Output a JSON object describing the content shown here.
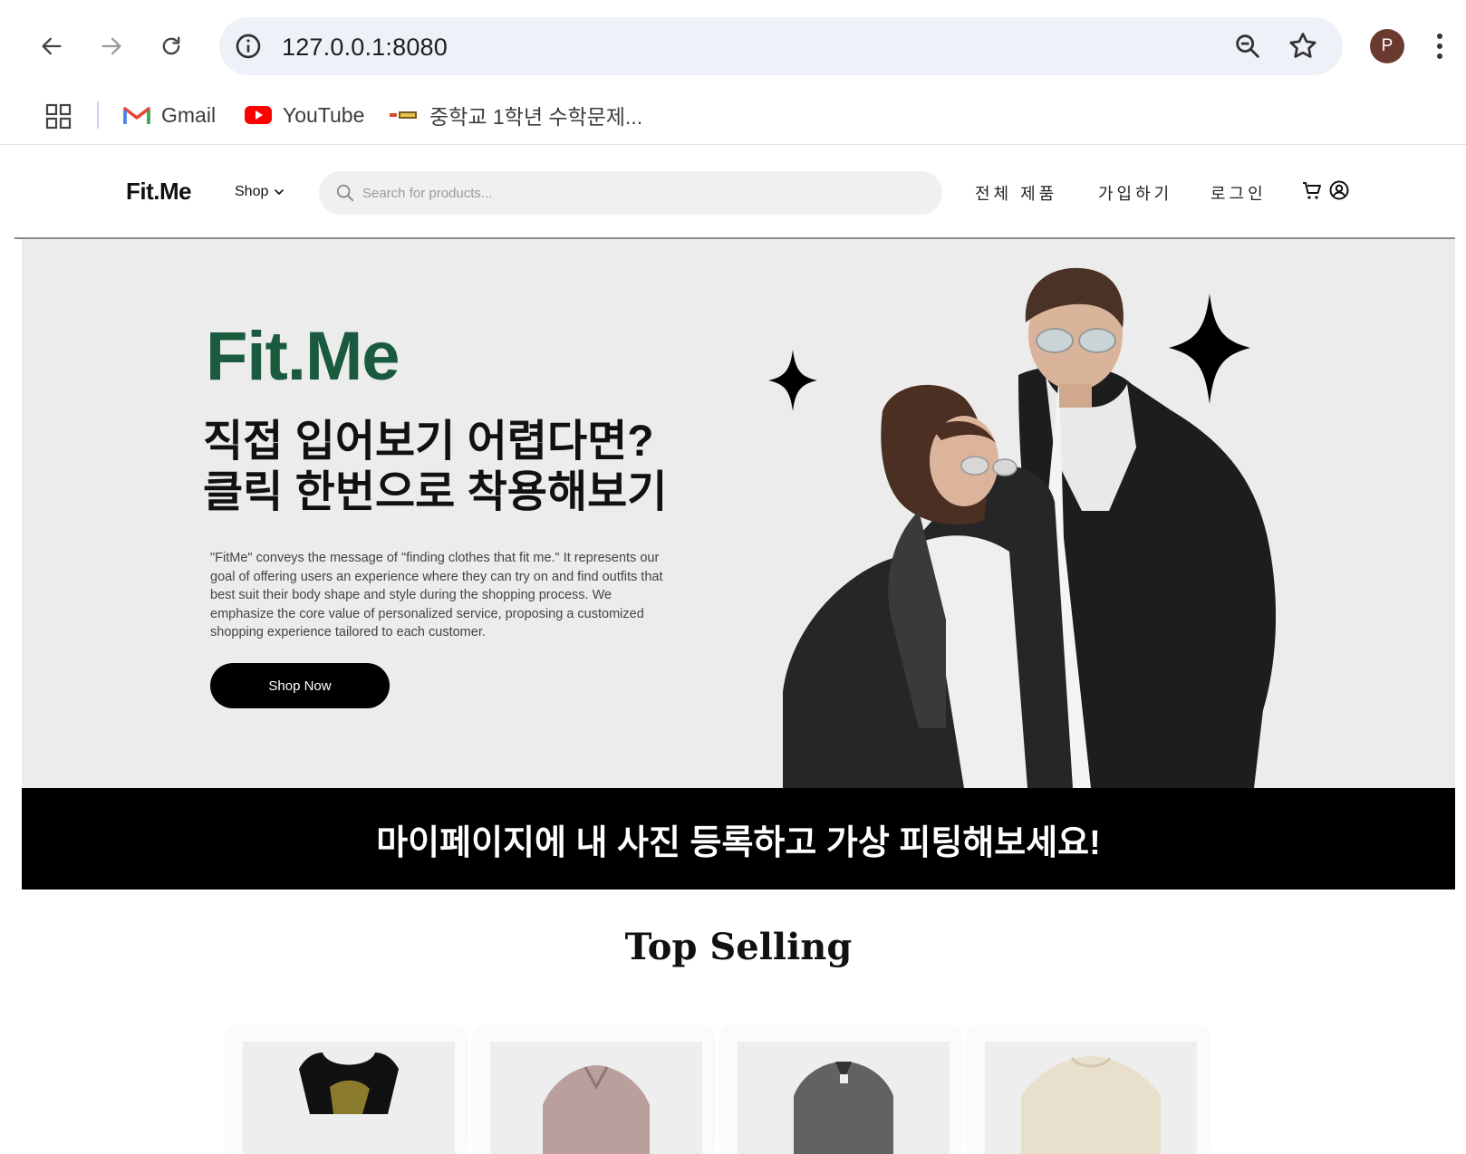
{
  "browser": {
    "url": "127.0.0.1:8080",
    "profile_initial": "P",
    "bookmarks": [
      {
        "label": "Gmail",
        "icon": "gmail-icon"
      },
      {
        "label": "YouTube",
        "icon": "youtube-icon"
      },
      {
        "label": "중학교 1학년 수학문제...",
        "icon": "site-favicon-icon"
      }
    ]
  },
  "site": {
    "logo": "Fit.Me",
    "shop_menu": "Shop",
    "search_placeholder": "Search for products...",
    "nav": [
      "전체 제품",
      "가입하기",
      "로그인"
    ],
    "icons": [
      "cart-icon",
      "user-circle-icon"
    ]
  },
  "hero": {
    "brand": "Fit.Me",
    "headline_line1": "직접 입어보기 어렵다면?",
    "headline_line2": "클릭 한번으로 착용해보기",
    "description": "\"FitMe\" conveys the message of \"finding clothes that fit me.\" It represents our goal of offering users an experience where they can try on and find outfits that best suit their body shape and style during the shopping process. We emphasize the core value of personalized service, proposing a customized shopping experience tailored to each customer.",
    "cta": "Shop Now",
    "brand_color": "#1a5a3e"
  },
  "banner": {
    "text": "마이페이지에 내 사진 등록하고 가상 피팅해보세요!"
  },
  "top_selling": {
    "title": "Top Selling",
    "products": [
      {
        "image": "black-tank-top-with-palm-print"
      },
      {
        "image": "pink-fleece-jacket"
      },
      {
        "image": "gray-blazer"
      },
      {
        "image": "cream-sweatshirt"
      }
    ]
  }
}
